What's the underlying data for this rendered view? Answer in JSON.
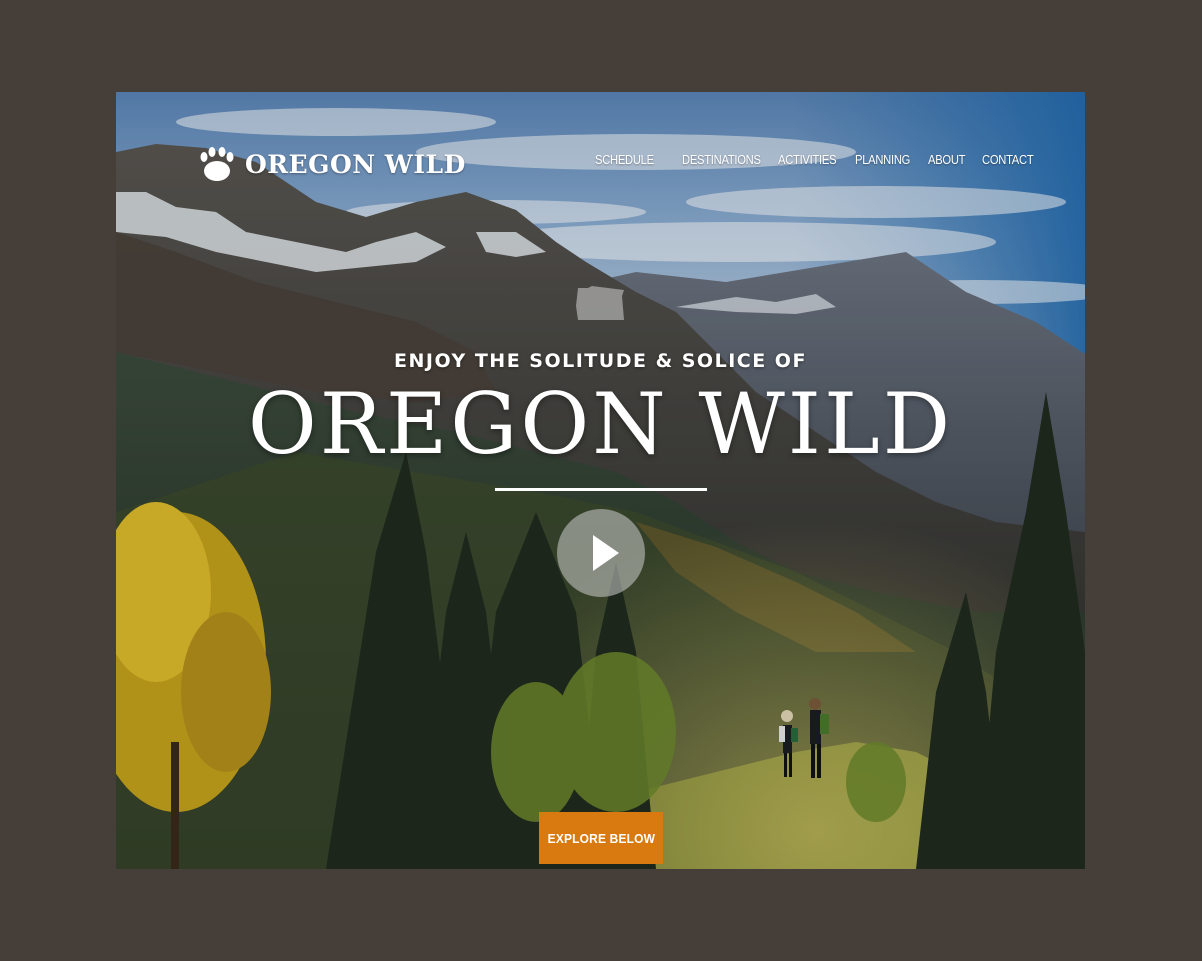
{
  "site": {
    "logo_text": "OREGON WILD",
    "logo_icon": "paw-print-icon"
  },
  "nav": {
    "items": [
      {
        "label": "SCHEDULE"
      },
      {
        "label": "DESTINATIONS"
      },
      {
        "label": "ACTIVITIES"
      },
      {
        "label": "PLANNING"
      },
      {
        "label": "ABOUT"
      },
      {
        "label": "CONTACT"
      }
    ]
  },
  "hero": {
    "subtitle": "ENJOY THE SOLITUDE & SOLICE OF",
    "title": "OREGON WILD",
    "play_icon": "play-icon",
    "state_icon": "oregon-state-icon"
  },
  "cta": {
    "label": "EXPLORE BELOW"
  },
  "colors": {
    "page_background": "#463f39",
    "accent": "#d87a10",
    "text": "#ffffff"
  }
}
